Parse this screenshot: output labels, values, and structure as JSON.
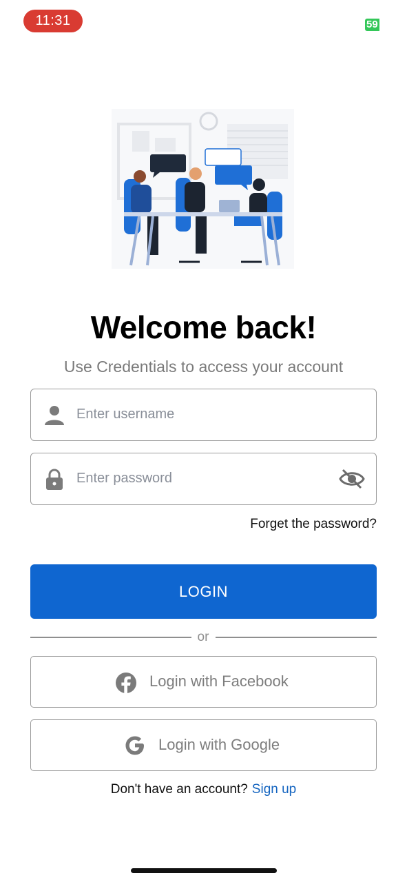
{
  "status_bar": {
    "time": "11:31",
    "battery": "59"
  },
  "header": {
    "title": "Welcome back!",
    "subtitle": "Use Credentials to access your account"
  },
  "form": {
    "username_placeholder": "Enter username",
    "password_placeholder": "Enter password",
    "forgot_label": "Forget the password?",
    "login_label": "LOGIN"
  },
  "divider": {
    "label": "or"
  },
  "social": {
    "facebook_label": "Login with Facebook",
    "google_label": "Login with Google"
  },
  "footer": {
    "question": "Don't have an account?",
    "signup_label": "Sign up"
  },
  "colors": {
    "accent": "#0f66d0",
    "link": "#1565c0",
    "time_pill": "#d93b32",
    "battery": "#34c759"
  }
}
